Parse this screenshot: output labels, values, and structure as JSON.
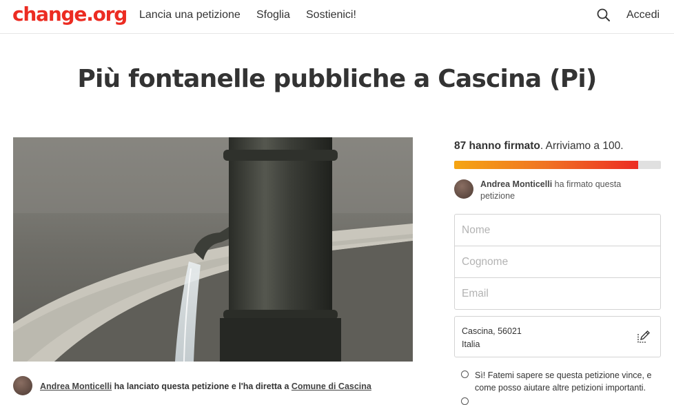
{
  "header": {
    "logo": "change.org",
    "nav": [
      "Lancia una petizione",
      "Sfoglia",
      "Sostienici!"
    ],
    "search_icon": "search-icon",
    "login": "Accedi"
  },
  "petition": {
    "title": "Più fontanelle pubbliche a Cascina (Pi)",
    "hero_alt": "fontanella pubblica",
    "starter_name": "Andrea Monticelli",
    "starter_mid": " ha lanciato questa petizione e l'ha diretta a ",
    "target": "Comune di Cascina"
  },
  "signatures": {
    "count_text": "87 hanno firmato",
    "goal_text": ". Arriviamo a 100.",
    "progress_fraction": 0.89,
    "recent_name": "Andrea Monticelli",
    "recent_action": " ha firmato questa petizione"
  },
  "form": {
    "first_name_placeholder": "Nome",
    "last_name_placeholder": "Cognome",
    "email_placeholder": "Email",
    "location_line1": "Cascina, 56021",
    "location_line2": "Italia",
    "optin_text": "Sì! Fatemi sapere se questa petizione vince, e come posso aiutare altre petizioni importanti."
  },
  "colors": {
    "brand": "#ec2c22",
    "progress_start": "#f5a512",
    "progress_end": "#ec2c22"
  }
}
